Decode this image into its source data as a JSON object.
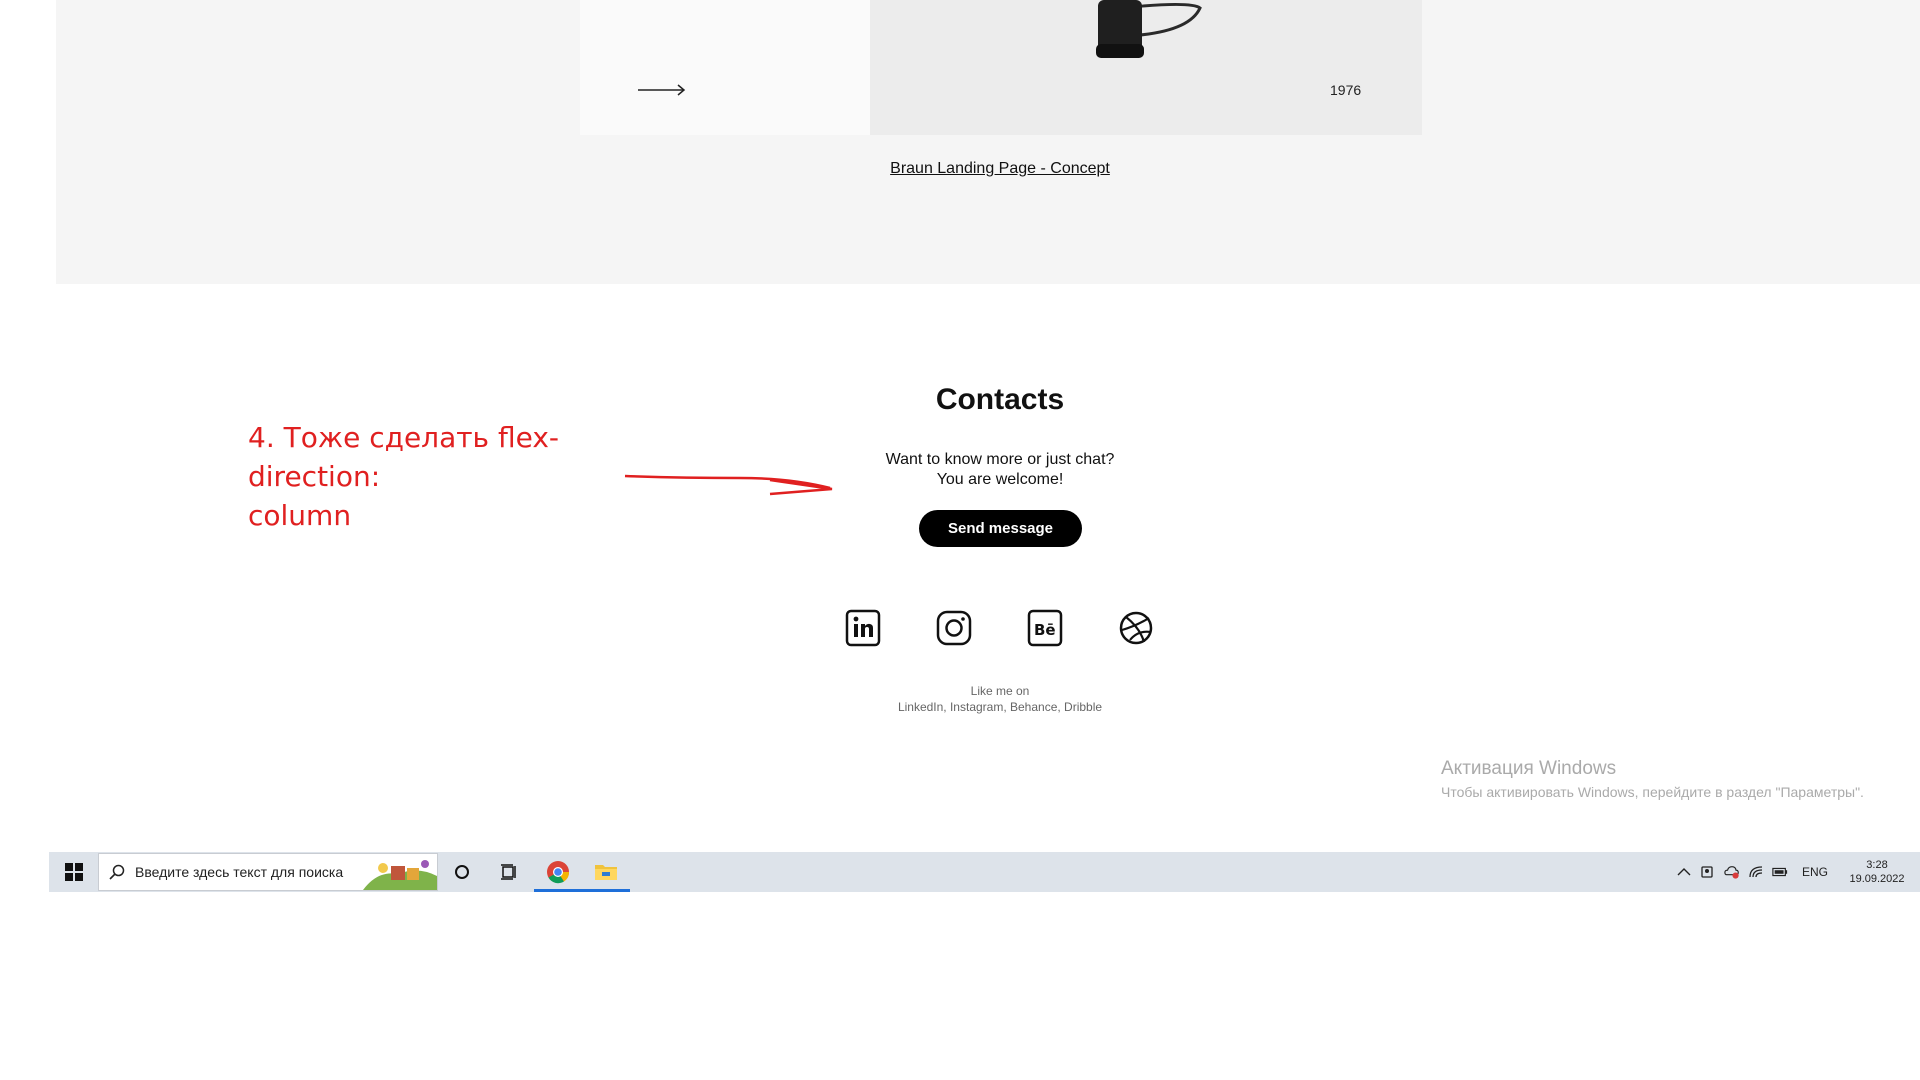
{
  "project": {
    "year": "1976",
    "link_text": "Braun Landing Page - Concept"
  },
  "contacts": {
    "title": "Contacts",
    "line1": "Want to know more or just chat?",
    "line2": "You are welcome!",
    "button_label": "Send message",
    "socials": [
      "linkedin-icon",
      "instagram-icon",
      "behance-icon",
      "dribbble-icon"
    ],
    "like_line1": "Like me on",
    "like_line2": "LinkedIn, Instagram, Behance, Dribble"
  },
  "annotation": {
    "line1": "4. Тоже сделать flex-direction:",
    "line2": "column",
    "color": "#e02020"
  },
  "watermark": {
    "title": "Активация Windows",
    "subtitle": "Чтобы активировать Windows, перейдите в раздел \"Параметры\"."
  },
  "taskbar": {
    "search_placeholder": "Введите здесь текст для поиска",
    "language": "ENG",
    "time": "3:28",
    "date": "19.09.2022",
    "accent": "#1e6fd9"
  }
}
